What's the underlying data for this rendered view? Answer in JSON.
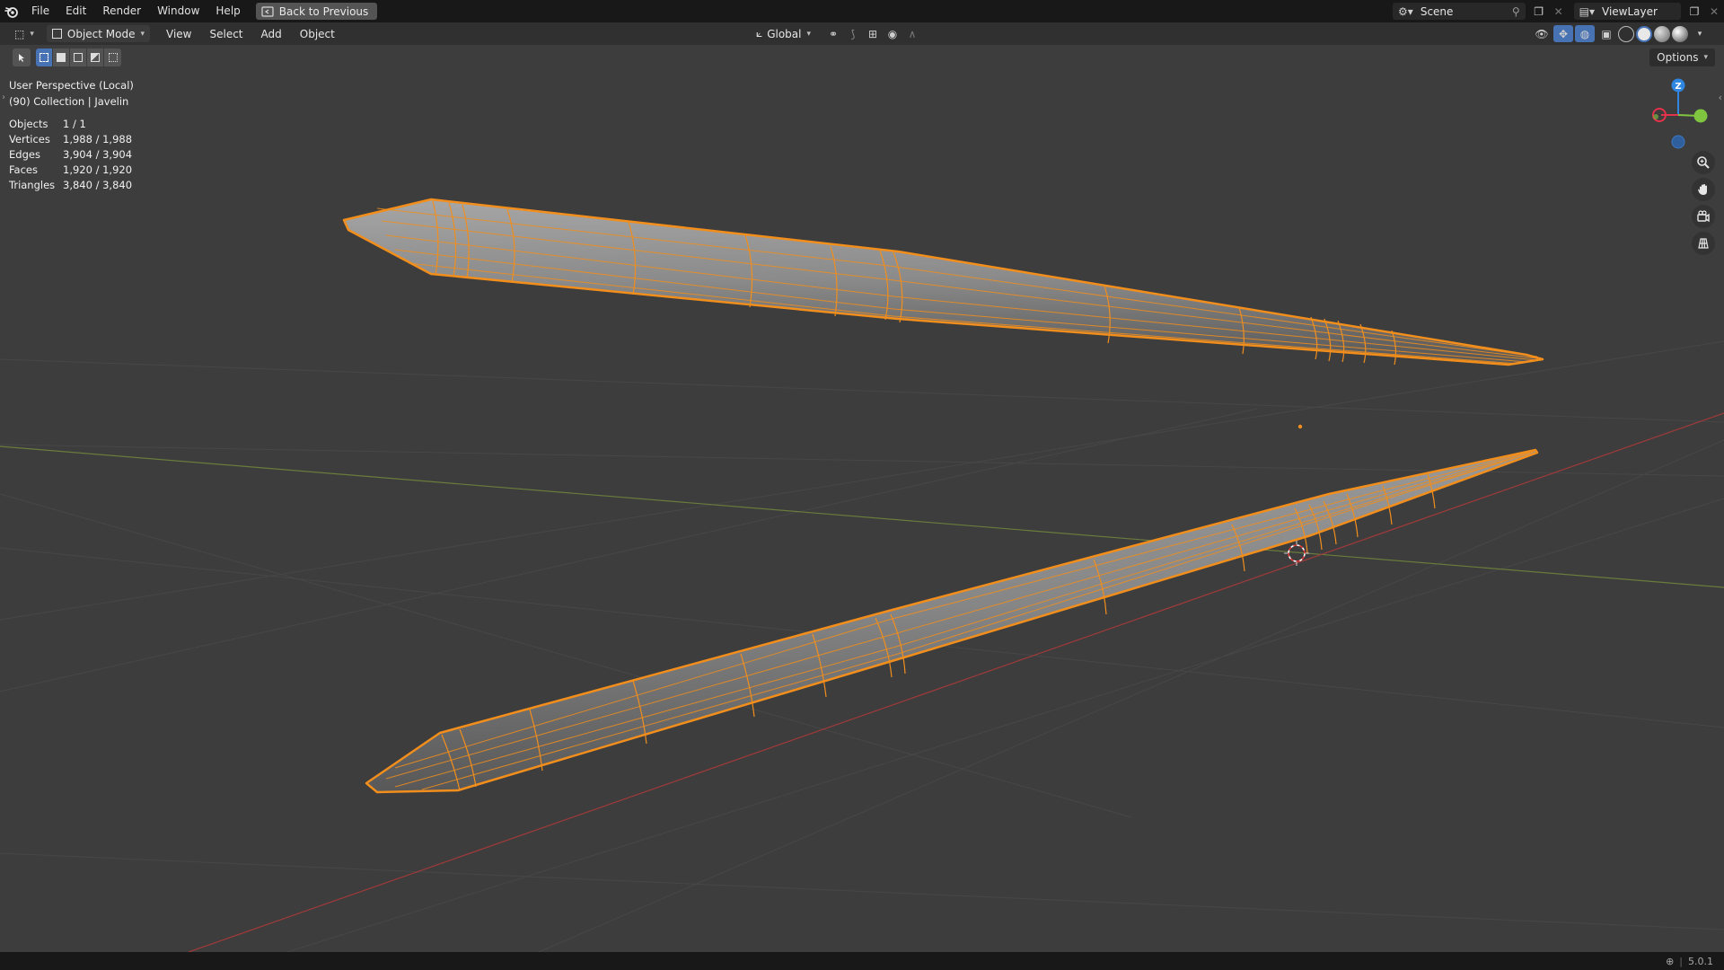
{
  "menubar": {
    "items": [
      "File",
      "Edit",
      "Render",
      "Window",
      "Help"
    ],
    "back_button": "Back to Previous",
    "scene_name": "Scene",
    "view_layer_name": "ViewLayer"
  },
  "header": {
    "mode": "Object Mode",
    "menus": [
      "View",
      "Select",
      "Add",
      "Object"
    ],
    "transform_orientation": "Global"
  },
  "toolbar": {
    "options_label": "Options"
  },
  "viewport": {
    "view_name": "User Perspective (Local)",
    "collection_info": "(90) Collection | Javelin",
    "stats": [
      {
        "label": "Objects",
        "value": "1 / 1"
      },
      {
        "label": "Vertices",
        "value": "1,988 / 1,988"
      },
      {
        "label": "Edges",
        "value": "3,904 / 3,904"
      },
      {
        "label": "Faces",
        "value": "1,920 / 1,920"
      },
      {
        "label": "Triangles",
        "value": "3,840 / 3,840"
      }
    ],
    "gizmo": {
      "z_label": "Z",
      "x_color": "#e2334a",
      "y_color": "#80c53f",
      "z_color": "#2f86e0"
    },
    "selection_color": "#f28e1c",
    "background_color": "#3d3d3d"
  },
  "statusbar": {
    "version": "5.0.1"
  }
}
